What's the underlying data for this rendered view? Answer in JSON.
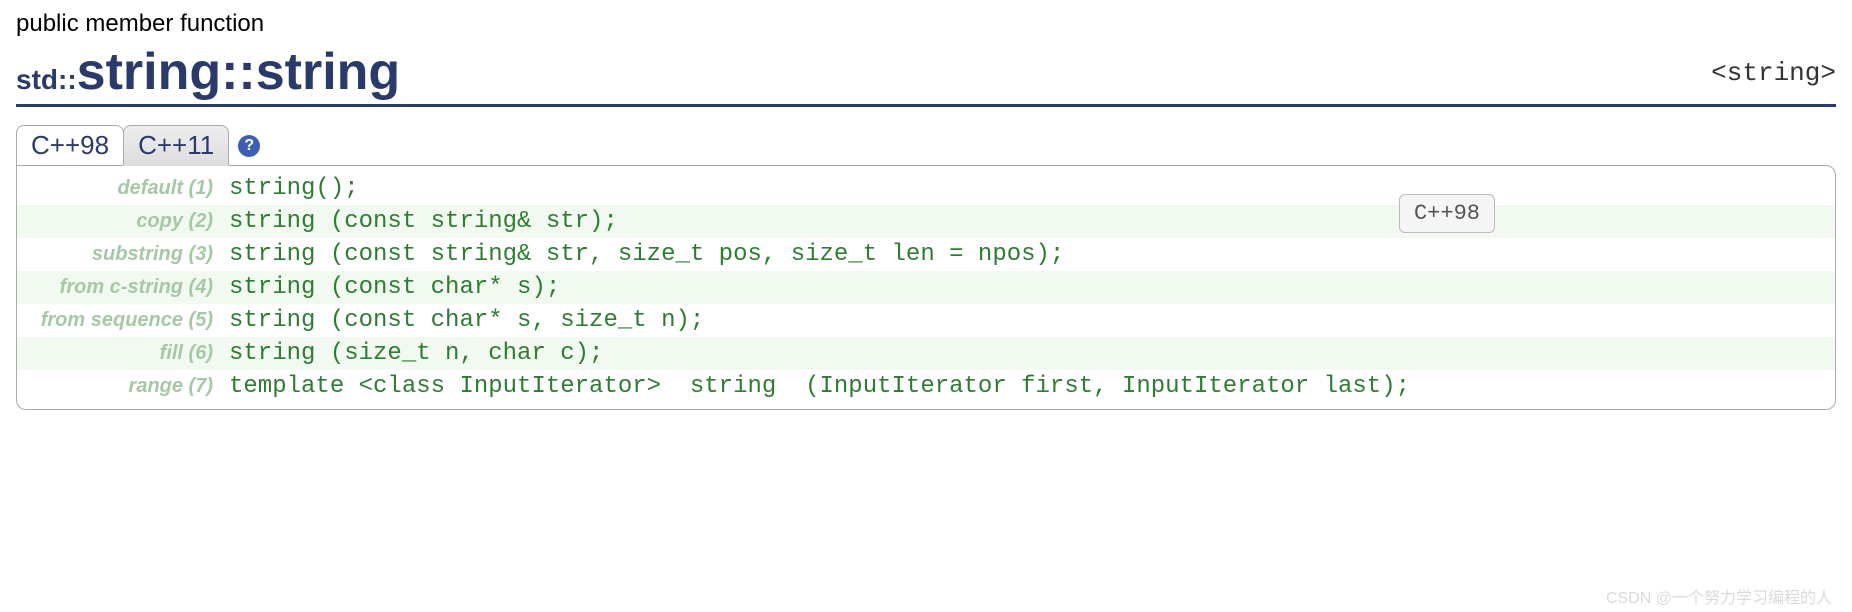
{
  "subtitle": "public member function",
  "title": {
    "namespace": "std::",
    "class": "string",
    "sep": "::",
    "member": "string"
  },
  "header_include": "<string>",
  "tabs": [
    {
      "label": "C++98"
    },
    {
      "label": "C++11"
    }
  ],
  "help_icon": "?",
  "tooltip": "C++98",
  "declarations": [
    {
      "label": "default (1)",
      "code": "string();"
    },
    {
      "label": "copy (2)",
      "code": "string (const string& str);"
    },
    {
      "label": "substring (3)",
      "code": "string (const string& str, size_t pos, size_t len = npos);"
    },
    {
      "label": "from c-string (4)",
      "code": "string (const char* s);"
    },
    {
      "label": "from sequence (5)",
      "code": "string (const char* s, size_t n);"
    },
    {
      "label": "fill (6)",
      "code": "string (size_t n, char c);"
    },
    {
      "label": "range (7)",
      "code": "template <class InputIterator>  string  (InputIterator first, InputIterator last);"
    }
  ],
  "watermark": "CSDN @一个努力学习编程的人"
}
